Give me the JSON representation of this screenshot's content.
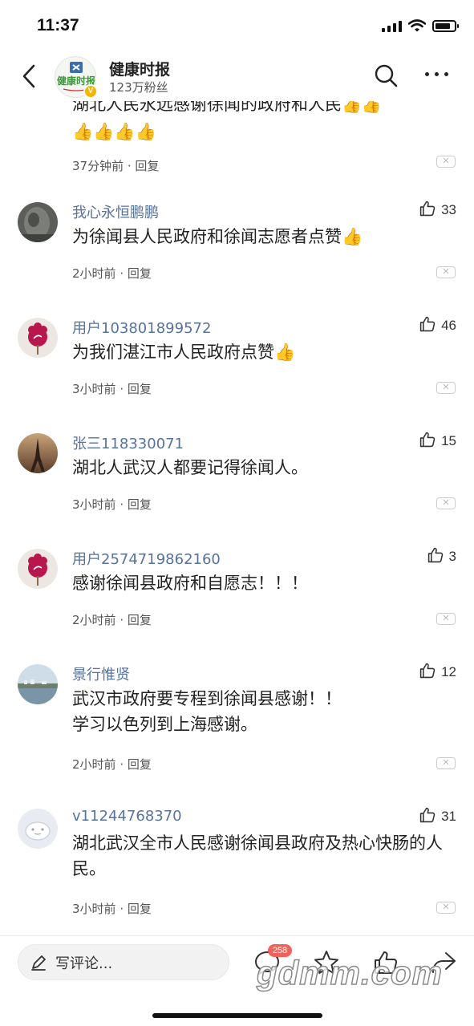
{
  "status_bar": {
    "time": "11:37",
    "battery_level": 0.8
  },
  "header": {
    "account_name": "健康时报",
    "fans": "123万粉丝",
    "verified_mark": "V",
    "logo_lettering": "健康时报"
  },
  "partial_comment": {
    "text": "湖北人民永远感谢徐闻的政府和人民",
    "second_line_emoji": "👍👍👍👍",
    "time": "37分钟前",
    "reply": "回复"
  },
  "comments": [
    {
      "user": "我心永恒鹏鹏",
      "likes": "33",
      "text": "为徐闻县人民政府和徐闻志愿者点赞👍",
      "time": "2小时前",
      "reply": "回复",
      "avatar": "stone-photo"
    },
    {
      "user": "用户103801899572",
      "likes": "46",
      "text": "为我们湛江市人民政府点赞👍",
      "time": "3小时前",
      "reply": "回复",
      "avatar": "default-flower"
    },
    {
      "user": "张三118330071",
      "likes": "15",
      "text": "湖北人武汉人都要记得徐闻人。",
      "time": "3小时前",
      "reply": "回复",
      "avatar": "eiffel-tower-photo"
    },
    {
      "user": "用户2574719862160",
      "likes": "3",
      "text": "感谢徐闻县政府和自愿志！！！",
      "time": "2小时前",
      "reply": "回复",
      "avatar": "default-flower"
    },
    {
      "user": "景行惟贤",
      "likes": "12",
      "text": "武汉市政府要专程到徐闻县感谢！！\n学习以色列到上海感谢。",
      "time": "2小时前",
      "reply": "回复",
      "avatar": "lake-photo"
    },
    {
      "user": "v11244768370",
      "likes": "31",
      "text": "湖北武汉全市人民感谢徐闻县政府及热心快肠的人民。",
      "time": "3小时前",
      "reply": "回复",
      "avatar": "default-cloud"
    }
  ],
  "dismiss_glyph": "✕",
  "meta_separator": " · ",
  "bottom_bar": {
    "input_placeholder": "写评论...",
    "comment_count": "258",
    "watermark": "gdmm.com",
    "icons": [
      "comment-icon",
      "star-icon",
      "like-icon",
      "share-icon"
    ]
  },
  "colors": {
    "username": "#56729e",
    "badge": "#f0625a",
    "verify": "#f5b400"
  }
}
